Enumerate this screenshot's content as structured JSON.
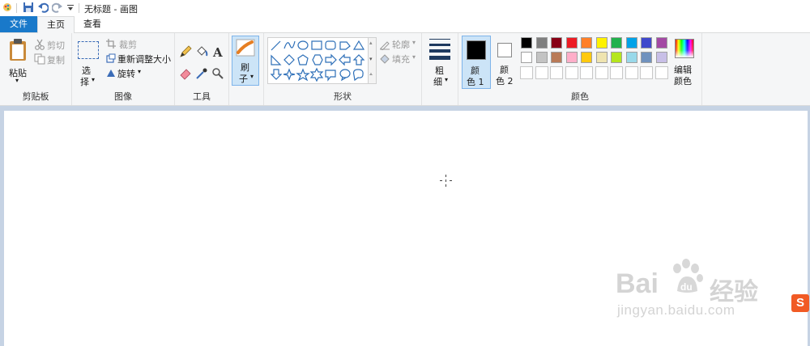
{
  "window": {
    "title": "无标题 - 画图"
  },
  "tabs": {
    "file": "文件",
    "home": "主页",
    "view": "查看"
  },
  "clipboard": {
    "paste": "粘贴",
    "cut": "剪切",
    "copy": "复制",
    "group_label": "剪贴板"
  },
  "image": {
    "select_line1": "选",
    "select_line2": "择",
    "crop": "裁剪",
    "resize": "重新调整大小",
    "rotate": "旋转",
    "group_label": "图像"
  },
  "tools": {
    "group_label": "工具"
  },
  "brushes": {
    "line1": "刷",
    "line2": "子"
  },
  "shapes": {
    "outline": "轮廓",
    "fill": "填充",
    "group_label": "形状"
  },
  "size": {
    "line1": "粗",
    "line2": "细"
  },
  "colors": {
    "color1_line1": "颜",
    "color1_line2": "色 1",
    "color2_line1": "颜",
    "color2_line2": "色 2",
    "edit_line1": "编辑",
    "edit_line2": "颜色",
    "group_label": "颜色",
    "color1": "#000000",
    "color2": "#ffffff",
    "palette_row1": [
      "#000000",
      "#7f7f7f",
      "#880015",
      "#ed1c24",
      "#ff7f27",
      "#fff200",
      "#22b14c",
      "#00a2e8",
      "#3f48cc",
      "#a349a4"
    ],
    "palette_row2": [
      "#ffffff",
      "#c3c3c3",
      "#b97a57",
      "#ffaec9",
      "#ffc90e",
      "#efe4b0",
      "#b5e61d",
      "#99d9ea",
      "#7092be",
      "#c8bfe7"
    ]
  },
  "watermark": {
    "brand": "Bai",
    "brand2": "du",
    "brand_cn": "经验",
    "url": "jingyan.baidu.com",
    "badge": "S"
  }
}
